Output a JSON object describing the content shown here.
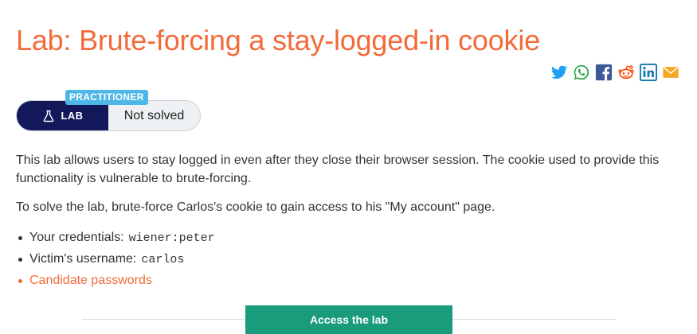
{
  "page": {
    "title": "Lab: Brute-forcing a stay-logged-in cookie"
  },
  "share": {
    "icons": [
      "twitter-icon",
      "whatsapp-icon",
      "facebook-icon",
      "reddit-icon",
      "linkedin-icon",
      "email-icon"
    ],
    "colors": {
      "twitter": "#1da1f2",
      "whatsapp": "#25a244",
      "facebook": "#3b5998",
      "reddit": "#ff4500",
      "linkedin": "#0e76a8",
      "email": "#f5a623"
    }
  },
  "lab_status": {
    "level": "PRACTITIONER",
    "lab_label": "LAB",
    "status": "Not solved"
  },
  "description": {
    "paragraph_1": "This lab allows users to stay logged in even after they close their browser session. The cookie used to provide this functionality is vulnerable to brute-forcing.",
    "paragraph_2": "To solve the lab, brute-force Carlos's cookie to gain access to his \"My account\" page."
  },
  "credentials": {
    "your_label": "Your credentials:",
    "your_value": "wiener:peter",
    "victim_label": "Victim's username:",
    "victim_value": "carlos",
    "candidate_link": "Candidate passwords"
  },
  "actions": {
    "access_label": "Access the lab"
  },
  "colors": {
    "accent": "#f26b3a",
    "lab_navy": "#12185a",
    "tag_blue": "#4fb7e8",
    "button_green": "#1a9b7c"
  }
}
